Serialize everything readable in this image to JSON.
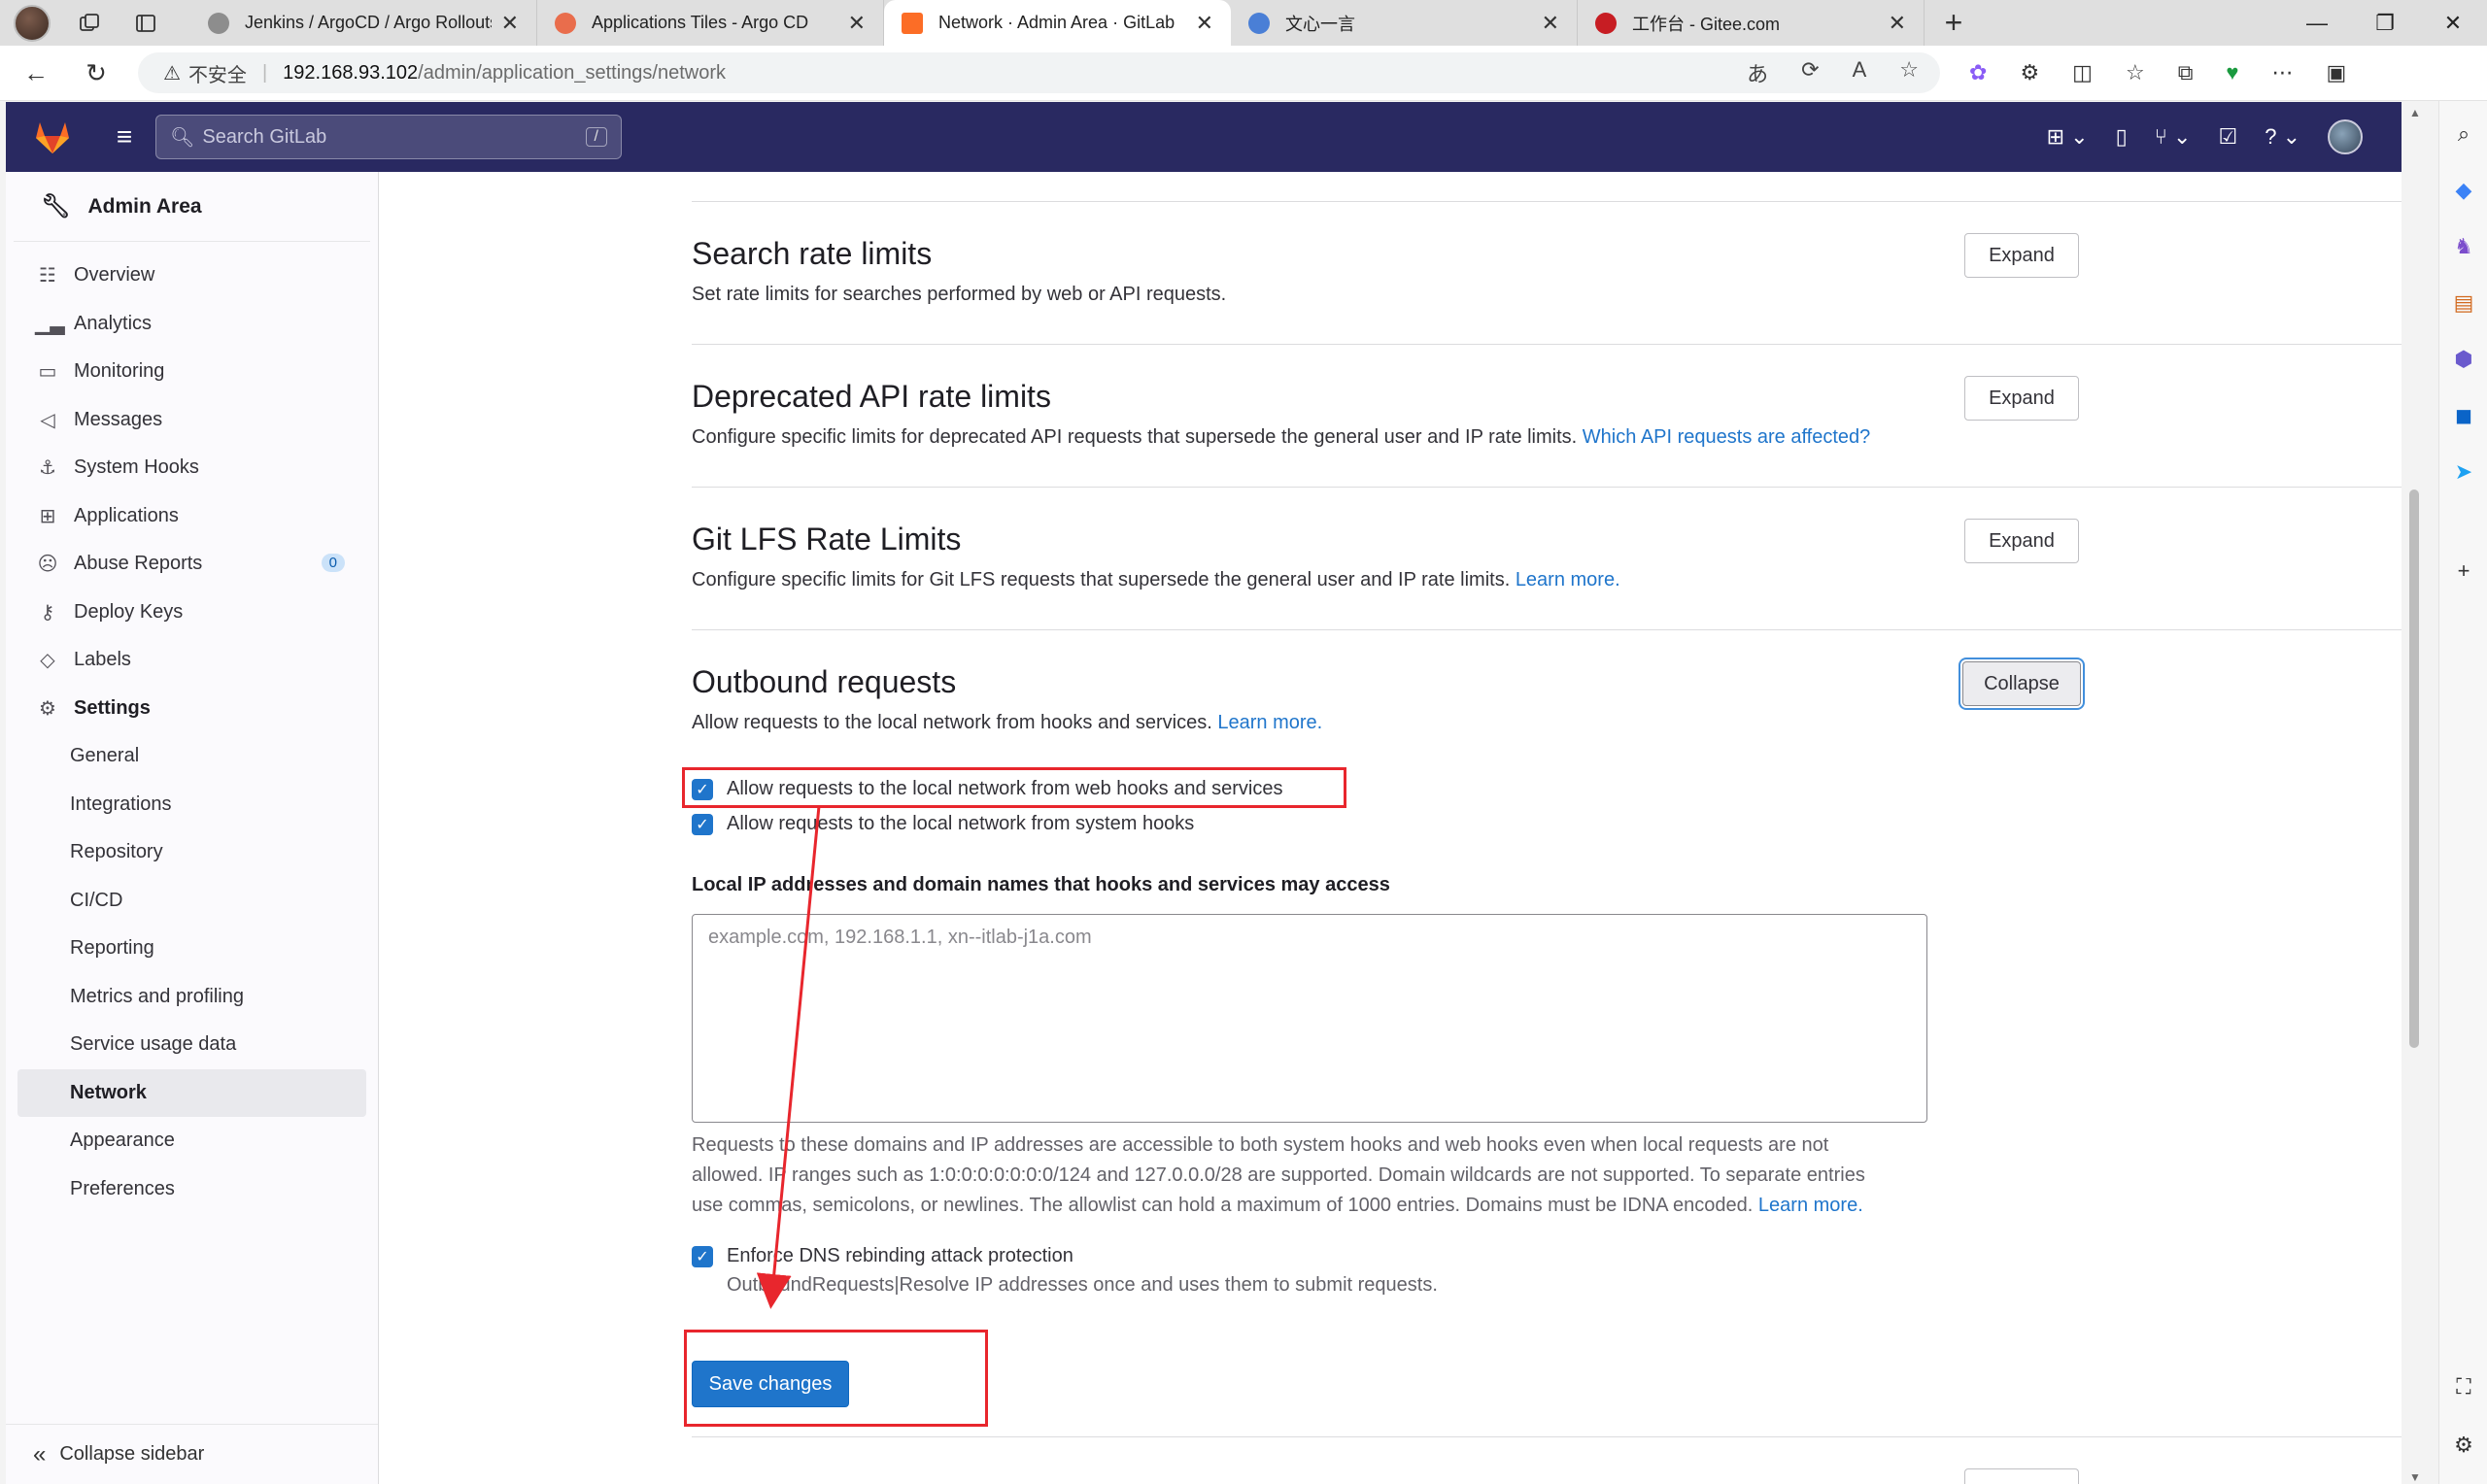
{
  "browser": {
    "tabs": [
      {
        "title": "Jenkins / ArgoCD / Argo Rollouts",
        "active": false
      },
      {
        "title": "Applications Tiles - Argo CD",
        "active": false
      },
      {
        "title": "Network · Admin Area · GitLab",
        "active": true
      },
      {
        "title": "文心一言",
        "active": false
      },
      {
        "title": "工作台 - Gitee.com",
        "active": false
      }
    ],
    "insecure_label": "不安全",
    "url_host": "192.168.93.102",
    "url_path": "/admin/application_settings/network"
  },
  "header": {
    "search_placeholder": "Search GitLab",
    "search_shortcut": "/"
  },
  "sidebar": {
    "title": "Admin Area",
    "items": [
      {
        "label": "Overview",
        "icon": "overview-icon"
      },
      {
        "label": "Analytics",
        "icon": "analytics-icon"
      },
      {
        "label": "Monitoring",
        "icon": "monitor-icon"
      },
      {
        "label": "Messages",
        "icon": "megaphone-icon"
      },
      {
        "label": "System Hooks",
        "icon": "anchor-icon"
      },
      {
        "label": "Applications",
        "icon": "applications-icon"
      },
      {
        "label": "Abuse Reports",
        "icon": "abuse-icon",
        "badge": "0"
      },
      {
        "label": "Deploy Keys",
        "icon": "key-icon"
      },
      {
        "label": "Labels",
        "icon": "label-icon"
      },
      {
        "label": "Settings",
        "icon": "settings-icon"
      }
    ],
    "settings_children": [
      "General",
      "Integrations",
      "Repository",
      "CI/CD",
      "Reporting",
      "Metrics and profiling",
      "Service usage data",
      "Network",
      "Appearance",
      "Preferences"
    ],
    "active_item": "Network",
    "collapse_label": "Collapse sidebar"
  },
  "sections": {
    "search_rate": {
      "title": "Search rate limits",
      "desc": "Set rate limits for searches performed by web or API requests.",
      "button": "Expand"
    },
    "deprecated_api": {
      "title": "Deprecated API rate limits",
      "desc": "Configure specific limits for deprecated API requests that supersede the general user and IP rate limits.",
      "link": "Which API requests are affected?",
      "button": "Expand"
    },
    "git_lfs": {
      "title": "Git LFS Rate Limits",
      "desc": "Configure specific limits for Git LFS requests that supersede the general user and IP rate limits.",
      "link": "Learn more.",
      "button": "Expand"
    },
    "outbound": {
      "title": "Outbound requests",
      "desc": "Allow requests to the local network from hooks and services.",
      "link": "Learn more.",
      "button": "Collapse",
      "check_web_hooks": "Allow requests to the local network from web hooks and services",
      "check_system_hooks": "Allow requests to the local network from system hooks",
      "allowlist_label": "Local IP addresses and domain names that hooks and services may access",
      "allowlist_placeholder": "example.com, 192.168.1.1, xn--itlab-j1a.com",
      "help_line1": "Requests to these domains and IP addresses are accessible to both system hooks and web hooks even when local requests are not",
      "help_line2": "allowed. IP ranges such as 1:0:0:0:0:0:0:0/124 and 127.0.0.0/28 are supported. Domain wildcards are not supported. To separate entries",
      "help_line3": "use commas, semicolons, or newlines. The allowlist can hold a maximum of 1000 entries. Domains must be IDNA encoded.",
      "help_link": "Learn more.",
      "check_dns": "Enforce DNS rebinding attack protection",
      "dns_help": "OutboundRequests|Resolve IP addresses once and uses them to submit requests.",
      "save_button": "Save changes"
    }
  },
  "colors": {
    "header_bg": "#292961",
    "primary": "#1f75cb",
    "annotation": "#e8262d"
  }
}
